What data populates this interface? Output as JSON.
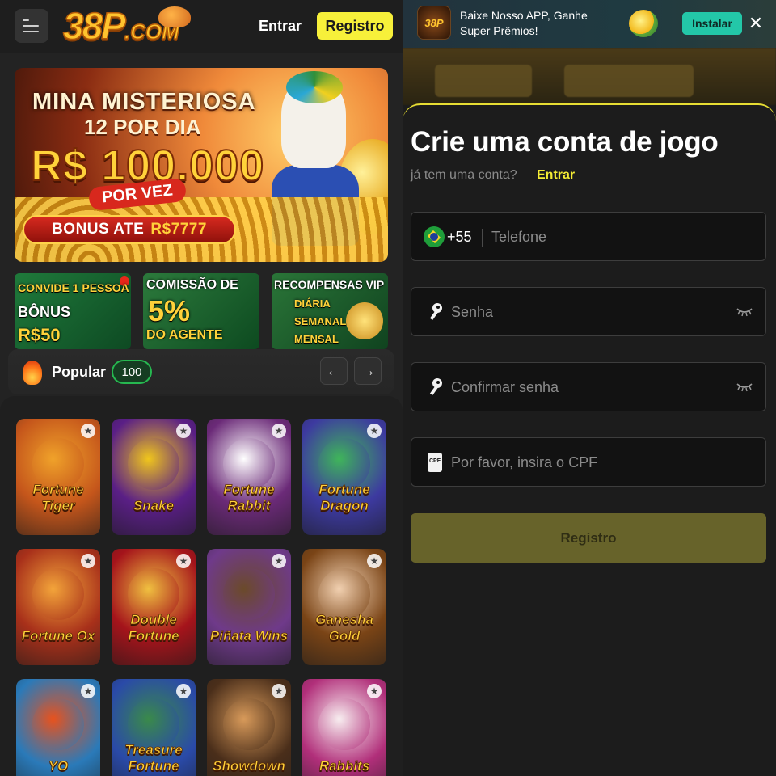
{
  "header": {
    "logo_text": "38P",
    "logo_suffix": ".COM",
    "login_label": "Entrar",
    "register_label": "Registro"
  },
  "hero_banner": {
    "line1": "MINA MISTERIOSA",
    "line2": "12 POR DIA",
    "amount": "R$ 100.000",
    "tag": "POR VEZ",
    "bonus_prefix": "BONUS ATE",
    "bonus_amount": "R$7777"
  },
  "promos": [
    {
      "line1": "CONVIDE 1 PESSOA",
      "line2": "BÔNUS",
      "line3": "R$50"
    },
    {
      "line1": "COMISSÃO DE",
      "line2": "5%",
      "line3": "DO AGENTE"
    },
    {
      "line1": "RECOMPENSAS VIP",
      "line2": "DIÁRIA",
      "line3": "SEMANAL",
      "line4": "MENSAL"
    }
  ],
  "popular": {
    "label": "Popular",
    "count": "100",
    "prev_icon": "arrow-left-icon",
    "next_icon": "arrow-right-icon"
  },
  "games": [
    {
      "title": "Fortune Tiger",
      "color": "#c5561b",
      "accent": "#f0a22a"
    },
    {
      "title": "Snake",
      "color": "#5a1f86",
      "accent": "#f0c61c"
    },
    {
      "title": "Fortune Rabbit",
      "color": "#6b2a78",
      "accent": "#ffffff"
    },
    {
      "title": "Fortune Dragon",
      "color": "#3d3aa0",
      "accent": "#3fb55a"
    },
    {
      "title": "Fortune Ox",
      "color": "#a8301a",
      "accent": "#f3a43a"
    },
    {
      "title": "Double Fortune",
      "color": "#a5141b",
      "accent": "#f0c040"
    },
    {
      "title": "Piñata Wins",
      "color": "#6f3a8a",
      "accent": "#6b4a2a"
    },
    {
      "title": "Ganesha Gold",
      "color": "#7a4416",
      "accent": "#f1d0b0"
    },
    {
      "title": "YO",
      "color": "#2a7ab9",
      "accent": "#e8521d"
    },
    {
      "title": "Treasure Fortune",
      "color": "#2a4aa8",
      "accent": "#3a8a4a"
    },
    {
      "title": "Showdown",
      "color": "#4a2e1a",
      "accent": "#d89a5a"
    },
    {
      "title": "Rabbits",
      "color": "#b12f7a",
      "accent": "#f8eef0"
    }
  ],
  "app_banner": {
    "logo_text": "38P",
    "message_line1": "Baixe Nosso APP, Ganhe",
    "message_line2": "Super Prêmios!",
    "install_label": "Instalar",
    "close_label": "✕"
  },
  "register_form": {
    "title": "Crie uma conta de jogo",
    "have_account": "já tem uma conta?",
    "login_link": "Entrar",
    "country_code": "+55",
    "phone_placeholder": "Telefone",
    "password_placeholder": "Senha",
    "confirm_placeholder": "Confirmar senha",
    "cpf_placeholder": "Por favor, insira o CPF",
    "cpf_icon_text": "CPF",
    "submit_label": "Registro"
  },
  "colors": {
    "accent_yellow": "#f4ec34",
    "register_button": "#67632a",
    "install_button": "#23c7a8"
  }
}
